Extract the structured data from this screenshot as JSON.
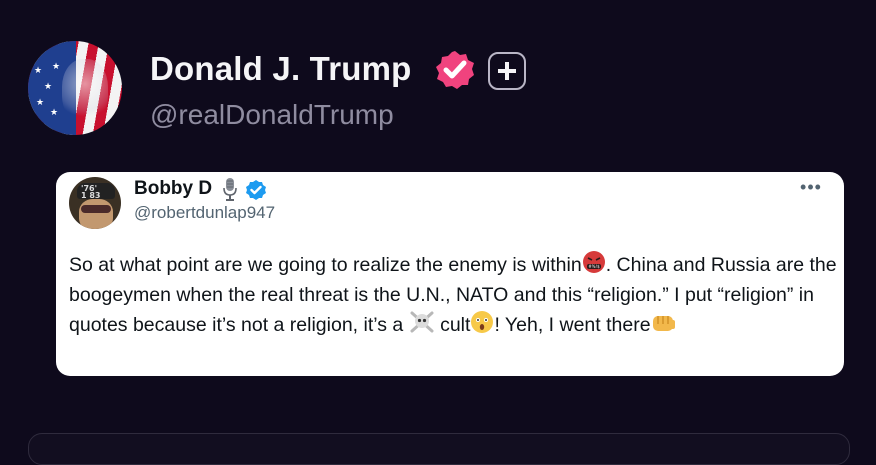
{
  "profile": {
    "display_name": "Donald J. Trump",
    "handle": "@realDonaldTrump",
    "verified_icon": "verified-badge-icon",
    "verified_color": "#f0437e",
    "follow_icon": "plus-icon"
  },
  "quoted_post": {
    "display_name": "Bobby D",
    "name_emoji": "microphone-icon",
    "verified_color": "#1d9bf0",
    "handle": "@robertdunlap947",
    "more_icon": "more-options-icon",
    "avatar_cap_text": "'76'\n1 83",
    "text": {
      "part1": "So at what point are we going to realize the enemy is within",
      "part2": ". China and Russia are the boogeymen when the real threat is the U.N., NATO and this “religion.” I put “religion” in quotes because it’s not a religion, it’s a ",
      "part3": " cult",
      "part4": "! Yeh, I went there"
    },
    "emojis": [
      "angry-cursing-face-emoji",
      "skull-crossbones-emoji",
      "astonished-face-emoji",
      "fist-emoji"
    ]
  },
  "colors": {
    "background": "#0e0a1c",
    "card": "#ffffff",
    "text_primary": "#0f1419",
    "text_secondary": "#536471"
  }
}
